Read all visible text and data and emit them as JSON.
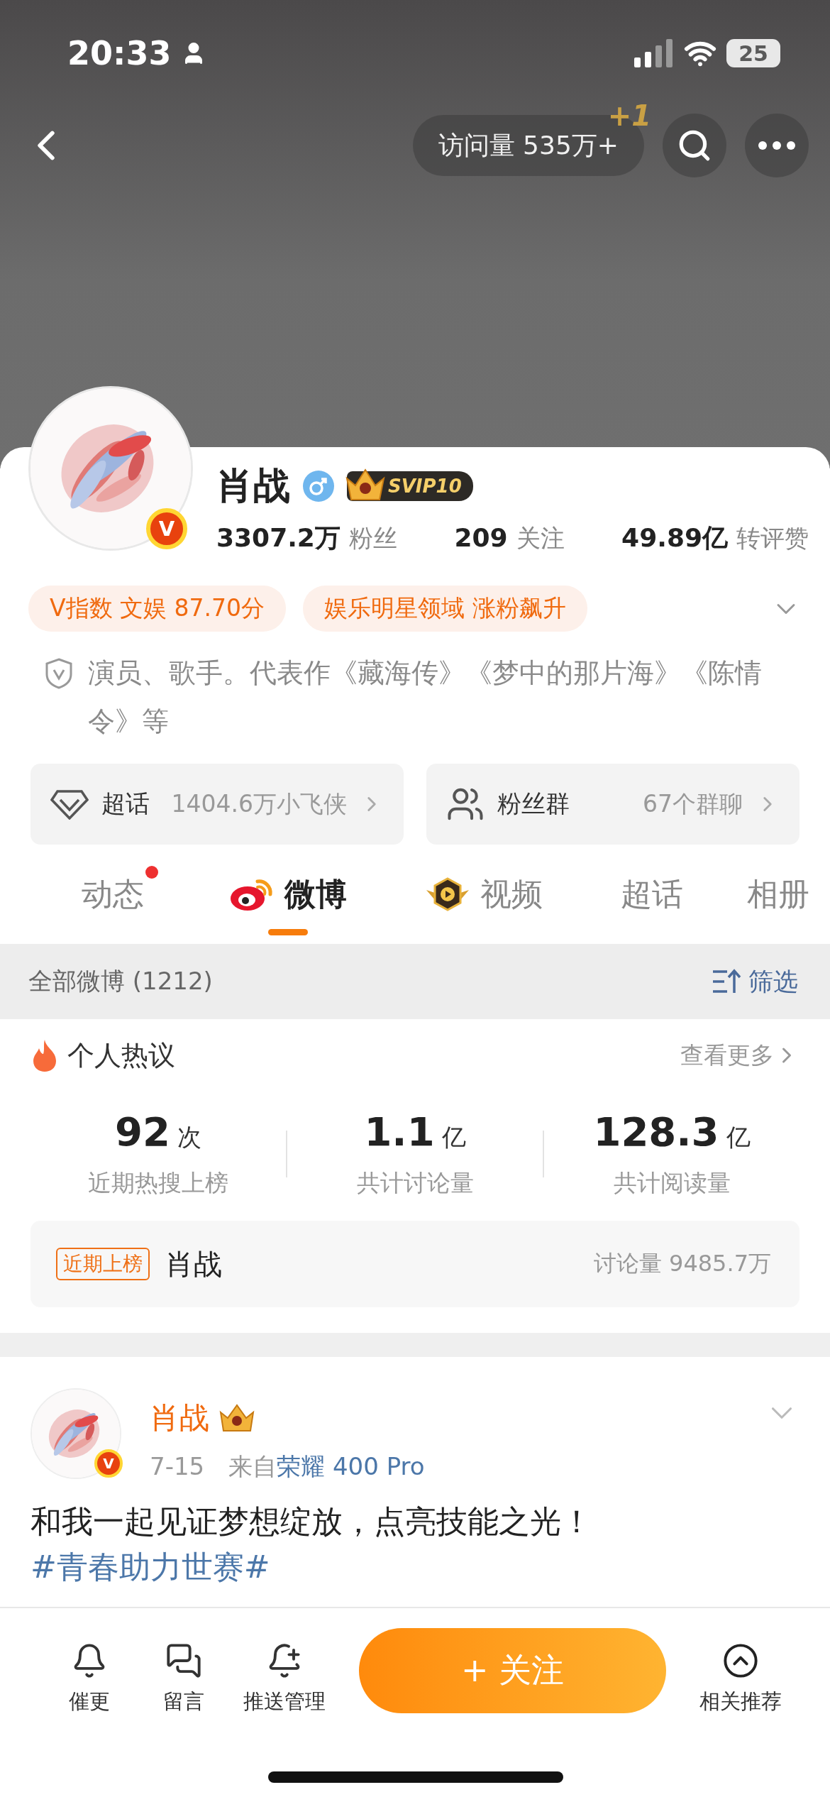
{
  "status_bar": {
    "time": "20:33",
    "battery": "25"
  },
  "top_bar": {
    "visits": "访问量 535万+",
    "visits_badge": "+1"
  },
  "profile": {
    "verified_mark": "V",
    "name": "肖战",
    "vip_badge": "SVIP10",
    "stats": [
      {
        "value": "3307.2万",
        "label": "粉丝"
      },
      {
        "value": "209",
        "label": "关注"
      },
      {
        "value": "49.89亿",
        "label": "转评赞"
      }
    ],
    "tags": [
      "V指数 文娱 87.70分",
      "娱乐明星领域 涨粉飙升"
    ],
    "bio": "演员、歌手。代表作《藏海传》《梦中的那片海》《陈情令》等"
  },
  "cards": [
    {
      "kind": "supertopic",
      "title": "超话",
      "detail": "1404.6万小飞侠"
    },
    {
      "kind": "fans",
      "title": "粉丝群",
      "detail": "67个群聊"
    }
  ],
  "tabs": [
    {
      "kind": "plain",
      "label": "动态",
      "dot": true,
      "selected": false
    },
    {
      "kind": "logo",
      "label": "微博",
      "dot": false,
      "selected": true
    },
    {
      "kind": "video",
      "label": "视频",
      "dot": false,
      "selected": false
    },
    {
      "kind": "plain",
      "label": "超话",
      "dot": false,
      "selected": false
    },
    {
      "kind": "plain",
      "label": "相册",
      "dot": false,
      "selected": false
    }
  ],
  "filter_bar": {
    "title": "全部微博 (1212)",
    "filter": "筛选"
  },
  "hot_topics": {
    "title": "个人热议",
    "more": "查看更多",
    "stats": [
      {
        "value": "92",
        "unit": "次",
        "label": "近期热搜上榜"
      },
      {
        "value": "1.1",
        "unit": "亿",
        "label": "共计讨论量"
      },
      {
        "value": "128.3",
        "unit": "亿",
        "label": "共计阅读量"
      }
    ],
    "entry": {
      "tag": "近期上榜",
      "name": "肖战",
      "count": "讨论量 9485.7万"
    }
  },
  "post": {
    "verified_mark": "V",
    "author": "肖战",
    "date": "7-15",
    "source_prefix": "来自",
    "source": "荣耀 400 Pro",
    "text": "和我一起见证梦想绽放，点亮技能之光！",
    "hashtag": "#青春助力世赛#"
  },
  "bottom_bar": {
    "actions": [
      {
        "kind": "bell",
        "label": "催更"
      },
      {
        "kind": "message",
        "label": "留言"
      },
      {
        "kind": "bell-plus",
        "label": "推送管理"
      }
    ],
    "follow": "+ 关注",
    "recommend": "相关推荐"
  }
}
